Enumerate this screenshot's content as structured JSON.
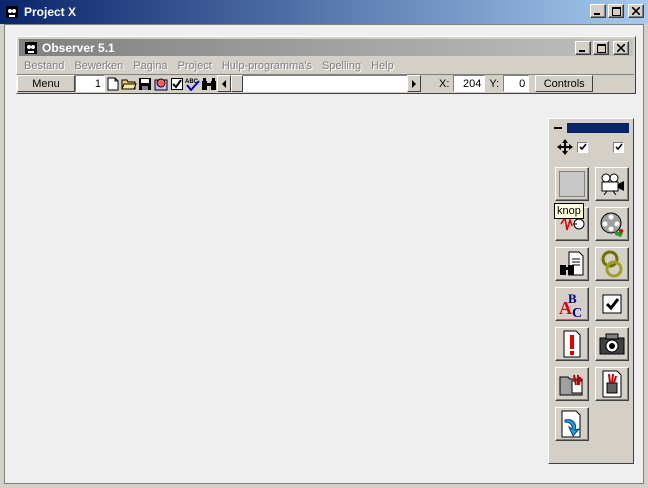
{
  "outer_window": {
    "title": "Project X"
  },
  "observer_window": {
    "title": "Observer 5.1",
    "menu": [
      "Bestand",
      "Bewerken",
      "Pagina",
      "Project",
      "Hulp-programma's",
      "Spelling",
      "Help"
    ]
  },
  "toolbar": {
    "menu_label": "Menu",
    "page_number": "1",
    "x_label": "X:",
    "x_value": "204",
    "y_label": "Y:",
    "y_value": "0",
    "controls_label": "Controls"
  },
  "tool_palette": {
    "tooltip": "knop",
    "tools": [
      "move-icon",
      "button-tool-icon",
      "camera-video-icon",
      "sound-icon",
      "film-reel-icon",
      "search-document-icon",
      "link-chain-icon",
      "spelling-abc-icon",
      "checkbox-tool-icon",
      "alert-exclamation-icon",
      "photo-camera-icon",
      "paint-folder-icon",
      "paint-page-icon",
      "jump-arrow-icon"
    ]
  },
  "colors": {
    "active_title": "#0a246a",
    "inactive_title": "#808080",
    "face": "#d4d0c8",
    "workspace": "#efefef"
  }
}
